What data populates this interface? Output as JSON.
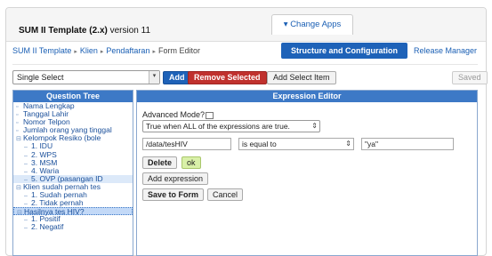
{
  "header": {
    "app_name": "SUM II Template (2.x)",
    "version": "version 11",
    "change_apps": "Change Apps"
  },
  "breadcrumb": {
    "items": [
      "SUM II Template",
      "Klien",
      "Pendaftaran",
      "Form Editor"
    ]
  },
  "tabs": {
    "active": "Structure and Configuration",
    "other": "Release Manager"
  },
  "toolbar": {
    "question_type": "Single Select",
    "add": "Add",
    "remove_selected": "Remove Selected",
    "add_select_item": "Add Select Item",
    "saved": "Saved"
  },
  "tree": {
    "title": "Question Tree",
    "items": [
      {
        "label": "Nama Lengkap",
        "level": 1,
        "marker": "text"
      },
      {
        "label": "Tanggal Lahir",
        "level": 1,
        "marker": "text"
      },
      {
        "label": "Nomor Telpon",
        "level": 1,
        "marker": "text"
      },
      {
        "label": "Jumlah orang yang tinggal",
        "level": 1,
        "marker": "text"
      },
      {
        "label": "Kelompok Resiko (bole",
        "level": 1,
        "marker": "select"
      },
      {
        "label": "1. IDU",
        "level": 2,
        "marker": "option"
      },
      {
        "label": "2. WPS",
        "level": 2,
        "marker": "option"
      },
      {
        "label": "3. MSM",
        "level": 2,
        "marker": "option"
      },
      {
        "label": "4. Waria",
        "level": 2,
        "marker": "option"
      },
      {
        "label": "5. OVP (pasangan ID",
        "level": 2,
        "marker": "option"
      },
      {
        "label": "Klien sudah pernah tes",
        "level": 1,
        "marker": "select"
      },
      {
        "label": "1. Sudah pernah",
        "level": 2,
        "marker": "option"
      },
      {
        "label": "2. Tidak pernah",
        "level": 2,
        "marker": "option"
      },
      {
        "label": "Hasilnya tes HIV?",
        "level": 1,
        "marker": "select"
      },
      {
        "label": "1. Positif",
        "level": 2,
        "marker": "option"
      },
      {
        "label": "2. Negatif",
        "level": 2,
        "marker": "option"
      }
    ]
  },
  "editor": {
    "title": "Expression Editor",
    "advanced_mode_label": "Advanced Mode?",
    "mode_option": "True when ALL of the expressions are true.",
    "path_value": "/data/tesHIV",
    "operator": "is equal to",
    "compare_value": "\"ya\"",
    "delete": "Delete",
    "ok": "ok",
    "add_expression": "Add expression",
    "save_to_form": "Save to Form",
    "cancel": "Cancel"
  },
  "colors": {
    "accent": "#1e62b8",
    "danger": "#c0312e",
    "panel_header": "#3d79c6",
    "ok_button": "#d9f0a8"
  }
}
